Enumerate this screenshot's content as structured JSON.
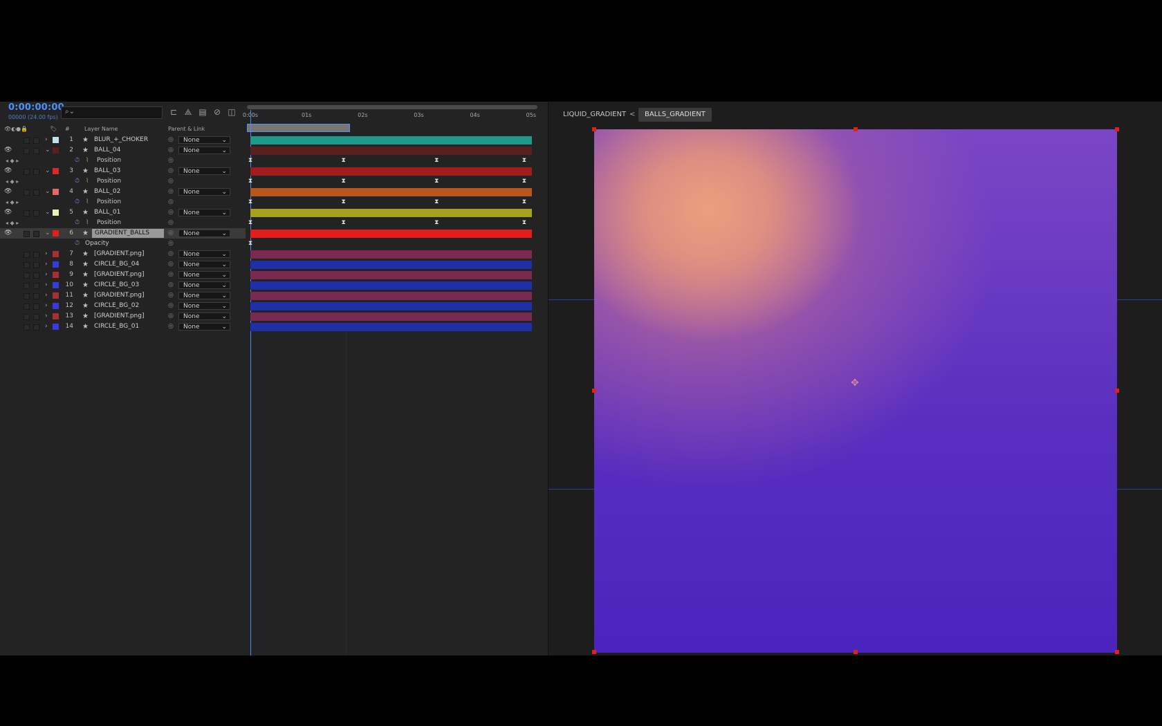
{
  "timeline": {
    "timecode": "0:00:00:00",
    "frame_info": "00000 (24.00 fps)",
    "search_placeholder": "",
    "columns": {
      "hash": "#",
      "layer_name": "Layer Name",
      "parent": "Parent & Link"
    },
    "ruler": [
      "0:00s",
      "01s",
      "02s",
      "03s",
      "04s",
      "05s"
    ],
    "rows": [
      {
        "type": "layer",
        "num": "1",
        "name": "BLUR_+_CHOKER",
        "label_color": "#bfe3e8",
        "twirl": ">",
        "parent": "None",
        "bar": "#1e9a8c",
        "eye": false
      },
      {
        "type": "layer",
        "num": "2",
        "name": "BALL_04",
        "label_color": "#5a2020",
        "twirl": "v",
        "parent": "None",
        "bar": "#5a1f1f",
        "eye": true
      },
      {
        "type": "prop",
        "name": "Position",
        "kf": [
          0,
          33.5,
          67,
          98.5
        ]
      },
      {
        "type": "layer",
        "num": "3",
        "name": "BALL_03",
        "label_color": "#d92a2a",
        "twirl": "v",
        "parent": "None",
        "bar": "#a11c1c",
        "eye": true
      },
      {
        "type": "prop",
        "name": "Position",
        "kf": [
          0,
          33.5,
          67,
          98.5
        ]
      },
      {
        "type": "layer",
        "num": "4",
        "name": "BALL_02",
        "label_color": "#e06a6a",
        "twirl": "v",
        "parent": "None",
        "bar": "#b8561e",
        "eye": true
      },
      {
        "type": "prop",
        "name": "Position",
        "kf": [
          0,
          33.5,
          67,
          98.5
        ]
      },
      {
        "type": "layer",
        "num": "5",
        "name": "BALL_01",
        "label_color": "#eef2b0",
        "twirl": "v",
        "parent": "None",
        "bar": "#a8a11e",
        "eye": true
      },
      {
        "type": "prop",
        "name": "Position",
        "kf": [
          0,
          33.5,
          67,
          98.5
        ]
      },
      {
        "type": "layer",
        "num": "6",
        "name": "GRADIENT_BALLS",
        "label_color": "#e21e1e",
        "twirl": "v",
        "parent": "None",
        "bar": "#e01e1e",
        "eye": true,
        "selected": true
      },
      {
        "type": "prop",
        "name": "Opacity",
        "kf": [
          0
        ]
      },
      {
        "type": "layer",
        "num": "7",
        "name": "[GRADIENT.png]",
        "label_color": "#a83030",
        "twirl": ">",
        "parent": "None",
        "bar": "#7a2a50",
        "eye": false
      },
      {
        "type": "layer",
        "num": "8",
        "name": "CIRCLE_BG_04",
        "label_color": "#3a3ad8",
        "twirl": ">",
        "parent": "None",
        "bar": "#1f2fa8",
        "eye": false
      },
      {
        "type": "layer",
        "num": "9",
        "name": "[GRADIENT.png]",
        "label_color": "#a83030",
        "twirl": ">",
        "parent": "None",
        "bar": "#7a2a50",
        "eye": false
      },
      {
        "type": "layer",
        "num": "10",
        "name": "CIRCLE_BG_03",
        "label_color": "#3a3ad8",
        "twirl": ">",
        "parent": "None",
        "bar": "#1f2fa8",
        "eye": false
      },
      {
        "type": "layer",
        "num": "11",
        "name": "[GRADIENT.png]",
        "label_color": "#a83030",
        "twirl": ">",
        "parent": "None",
        "bar": "#7a2a50",
        "eye": false
      },
      {
        "type": "layer",
        "num": "12",
        "name": "CIRCLE_BG_02",
        "label_color": "#3a3ad8",
        "twirl": ">",
        "parent": "None",
        "bar": "#1f2fa8",
        "eye": false
      },
      {
        "type": "layer",
        "num": "13",
        "name": "[GRADIENT.png]",
        "label_color": "#a83030",
        "twirl": ">",
        "parent": "None",
        "bar": "#7a2a50",
        "eye": false
      },
      {
        "type": "layer",
        "num": "14",
        "name": "CIRCLE_BG_01",
        "label_color": "#3a3ad8",
        "twirl": ">",
        "parent": "None",
        "bar": "#1f2fa8",
        "eye": false
      }
    ]
  },
  "viewer": {
    "breadcrumb": {
      "parent": "LIQUID_GRADIENT",
      "separator": "<",
      "current": "BALLS_GRADIENT"
    },
    "colors": {
      "warm": "#e99a7a",
      "purple": "#4a24bd"
    }
  }
}
